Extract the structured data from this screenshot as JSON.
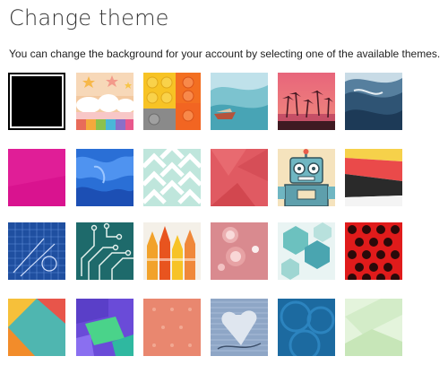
{
  "page": {
    "title": "Change theme",
    "description": "You can change the background for your account by selecting one of the available themes."
  },
  "themes": {
    "selected": "black",
    "items": [
      {
        "id": "black",
        "row": 1,
        "col": 1,
        "color": "#000000"
      },
      {
        "id": "stars-pastel",
        "row": 1,
        "col": 2
      },
      {
        "id": "building-blocks",
        "row": 1,
        "col": 3
      },
      {
        "id": "boat-wave",
        "row": 1,
        "col": 4
      },
      {
        "id": "palm-trees-sunset",
        "row": 1,
        "col": 5
      },
      {
        "id": "ocean-wave",
        "row": 1,
        "col": 6
      },
      {
        "id": "magenta",
        "row": 2,
        "col": 1
      },
      {
        "id": "blue-paint",
        "row": 2,
        "col": 2
      },
      {
        "id": "mint-chevrons",
        "row": 2,
        "col": 3
      },
      {
        "id": "coral-geometric",
        "row": 2,
        "col": 4
      },
      {
        "id": "robot",
        "row": 2,
        "col": 5
      },
      {
        "id": "red-black-slope",
        "row": 2,
        "col": 6
      },
      {
        "id": "blueprint",
        "row": 3,
        "col": 1
      },
      {
        "id": "circuit-board",
        "row": 3,
        "col": 2
      },
      {
        "id": "crayons",
        "row": 3,
        "col": 3
      },
      {
        "id": "bokeh-red",
        "row": 3,
        "col": 4
      },
      {
        "id": "teal-hexagons",
        "row": 3,
        "col": 5
      },
      {
        "id": "red-dots",
        "row": 3,
        "col": 6
      },
      {
        "id": "colorful-triangles",
        "row": 4,
        "col": 1
      },
      {
        "id": "green-purple-blocks",
        "row": 4,
        "col": 2
      },
      {
        "id": "peach-dots",
        "row": 4,
        "col": 3
      },
      {
        "id": "heart-fabric",
        "row": 4,
        "col": 4
      },
      {
        "id": "blue-circles",
        "row": 4,
        "col": 5
      },
      {
        "id": "pale-green-geometric",
        "row": 4,
        "col": 6
      }
    ]
  }
}
